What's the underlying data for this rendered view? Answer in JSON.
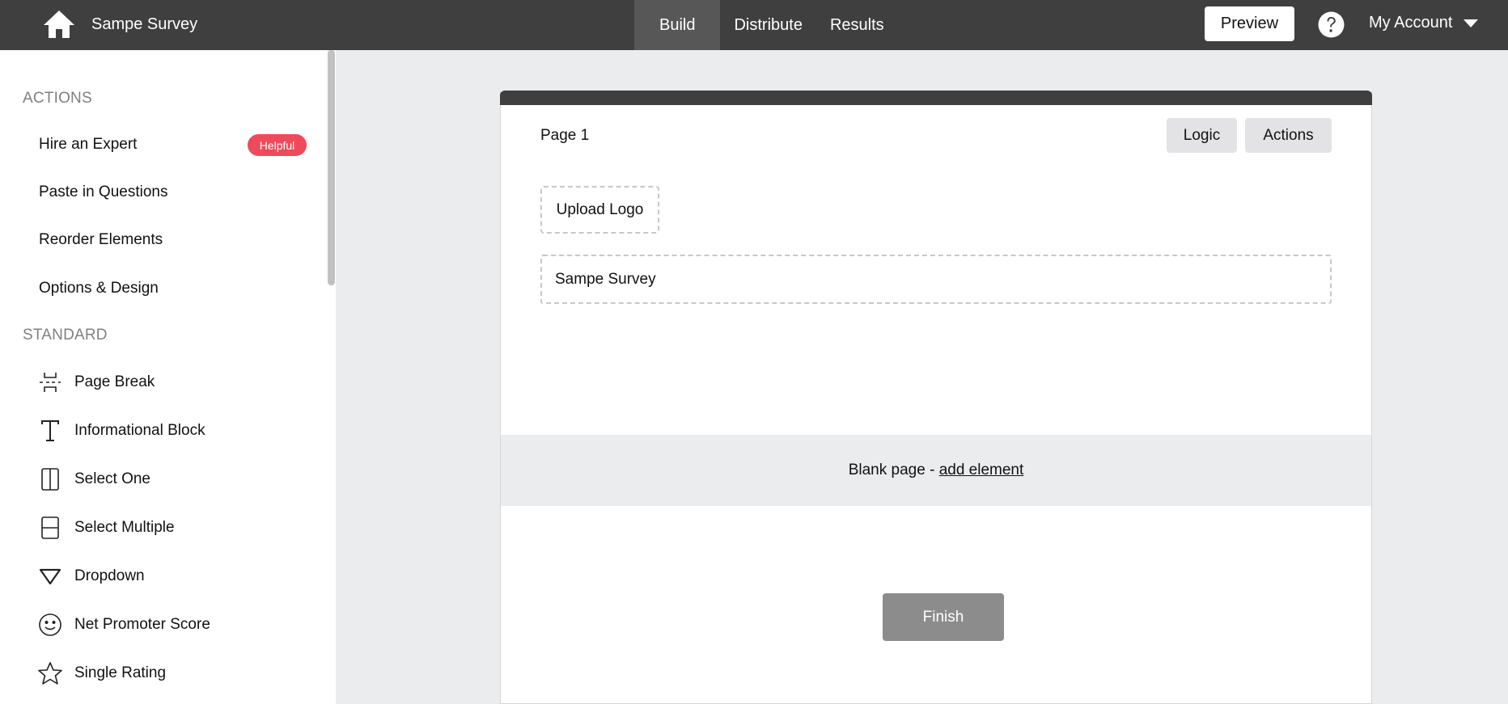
{
  "header": {
    "app_title": "Sampe Survey",
    "home_icon": "home-icon",
    "tabs": [
      {
        "label": "Build",
        "active": true
      },
      {
        "label": "Distribute",
        "active": false
      },
      {
        "label": "Results",
        "active": false
      }
    ],
    "preview_label": "Preview",
    "help_icon": "question-circle-icon",
    "account_label": "My Account"
  },
  "sidebar": {
    "actions_heading": "ACTIONS",
    "actions": [
      {
        "label": "Hire an Expert",
        "badge": "Helpful"
      },
      {
        "label": "Paste in Questions"
      },
      {
        "label": "Reorder Elements"
      },
      {
        "label": "Options & Design"
      }
    ],
    "standard_heading": "STANDARD",
    "standard": [
      {
        "label": "Page Break",
        "icon": "page-break-icon"
      },
      {
        "label": "Informational Block",
        "icon": "text-t-icon"
      },
      {
        "label": "Select One",
        "icon": "select-one-icon"
      },
      {
        "label": "Select Multiple",
        "icon": "select-multiple-icon"
      },
      {
        "label": "Dropdown",
        "icon": "triangle-down-icon"
      },
      {
        "label": "Net Promoter Score",
        "icon": "smiley-icon"
      },
      {
        "label": "Single Rating",
        "icon": "star-icon"
      }
    ]
  },
  "page": {
    "label": "Page 1",
    "logic_label": "Logic",
    "actions_label": "Actions",
    "upload_logo_label": "Upload Logo",
    "survey_title": "Sampe Survey",
    "blank_text": "Blank page - ",
    "add_element_label": "add element",
    "finish_label": "Finish"
  },
  "colors": {
    "topbar": "#3f3f3f",
    "active_tab": "#575757",
    "badge": "#ee4a5b",
    "finish_button": "#8c8c8c",
    "canvas_bg": "#ebecee"
  }
}
